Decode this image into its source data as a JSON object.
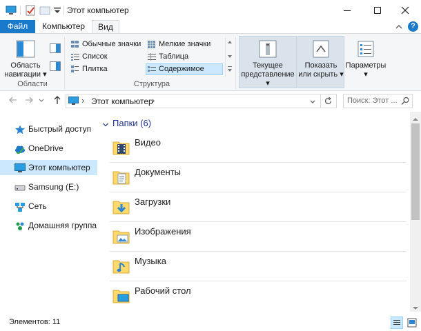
{
  "window": {
    "title": "Этот компьютер",
    "minimize_glyph": "—",
    "maximize_glyph": "☐",
    "close_glyph": "✕"
  },
  "ribbon": {
    "tabs": [
      "Файл",
      "Компьютер",
      "Вид"
    ],
    "active_tab": "Вид",
    "collapse_glyph": "⌃",
    "help_glyph": "?",
    "panes": {
      "nav_pane_label_1": "Область",
      "nav_pane_label_2": "навигации ▾",
      "group_label": "Области"
    },
    "layout": {
      "items": [
        "Обычные значки",
        "Мелкие значки",
        "Список",
        "Таблица",
        "Плитка",
        "Содержимое"
      ],
      "selected": "Содержимое",
      "group_label": "Структура"
    },
    "current_view": {
      "sort_label_1": "Текущее",
      "sort_label_2": "представление ▾",
      "show_hide_label_1": "Показать",
      "show_hide_label_2": "или скрыть ▾",
      "options_label": "Параметры",
      "options_arrow": "▾"
    }
  },
  "address": {
    "path_root_glyph": "›",
    "path": "Этот компьютер",
    "path_sep": "›",
    "dropdown_glyph": "⌄",
    "refresh_glyph": "↻",
    "search_placeholder": "Поиск: Этот ..."
  },
  "navigation": {
    "items": [
      {
        "label": "Быстрый доступ",
        "icon": "star-icon"
      },
      {
        "label": "OneDrive",
        "icon": "cloud-icon"
      },
      {
        "label": "Этот компьютер",
        "icon": "computer-icon"
      },
      {
        "label": "Samsung (E:)",
        "icon": "drive-icon"
      },
      {
        "label": "Сеть",
        "icon": "network-icon"
      },
      {
        "label": "Домашняя группа",
        "icon": "homegroup-icon"
      }
    ],
    "selected": "Этот компьютер"
  },
  "content": {
    "group_header": "Папки (6)",
    "folders": [
      {
        "name": "Видео",
        "icon": "videos-folder-icon"
      },
      {
        "name": "Документы",
        "icon": "documents-folder-icon"
      },
      {
        "name": "Загрузки",
        "icon": "downloads-folder-icon"
      },
      {
        "name": "Изображения",
        "icon": "pictures-folder-icon"
      },
      {
        "name": "Музыка",
        "icon": "music-folder-icon"
      },
      {
        "name": "Рабочий стол",
        "icon": "desktop-folder-icon"
      }
    ]
  },
  "status": {
    "items_count": "Элементов: 11"
  },
  "colors": {
    "accent": "#1979ca",
    "selection": "#cce8ff",
    "group_header": "#1e3287",
    "folder": "#ffd96b"
  }
}
